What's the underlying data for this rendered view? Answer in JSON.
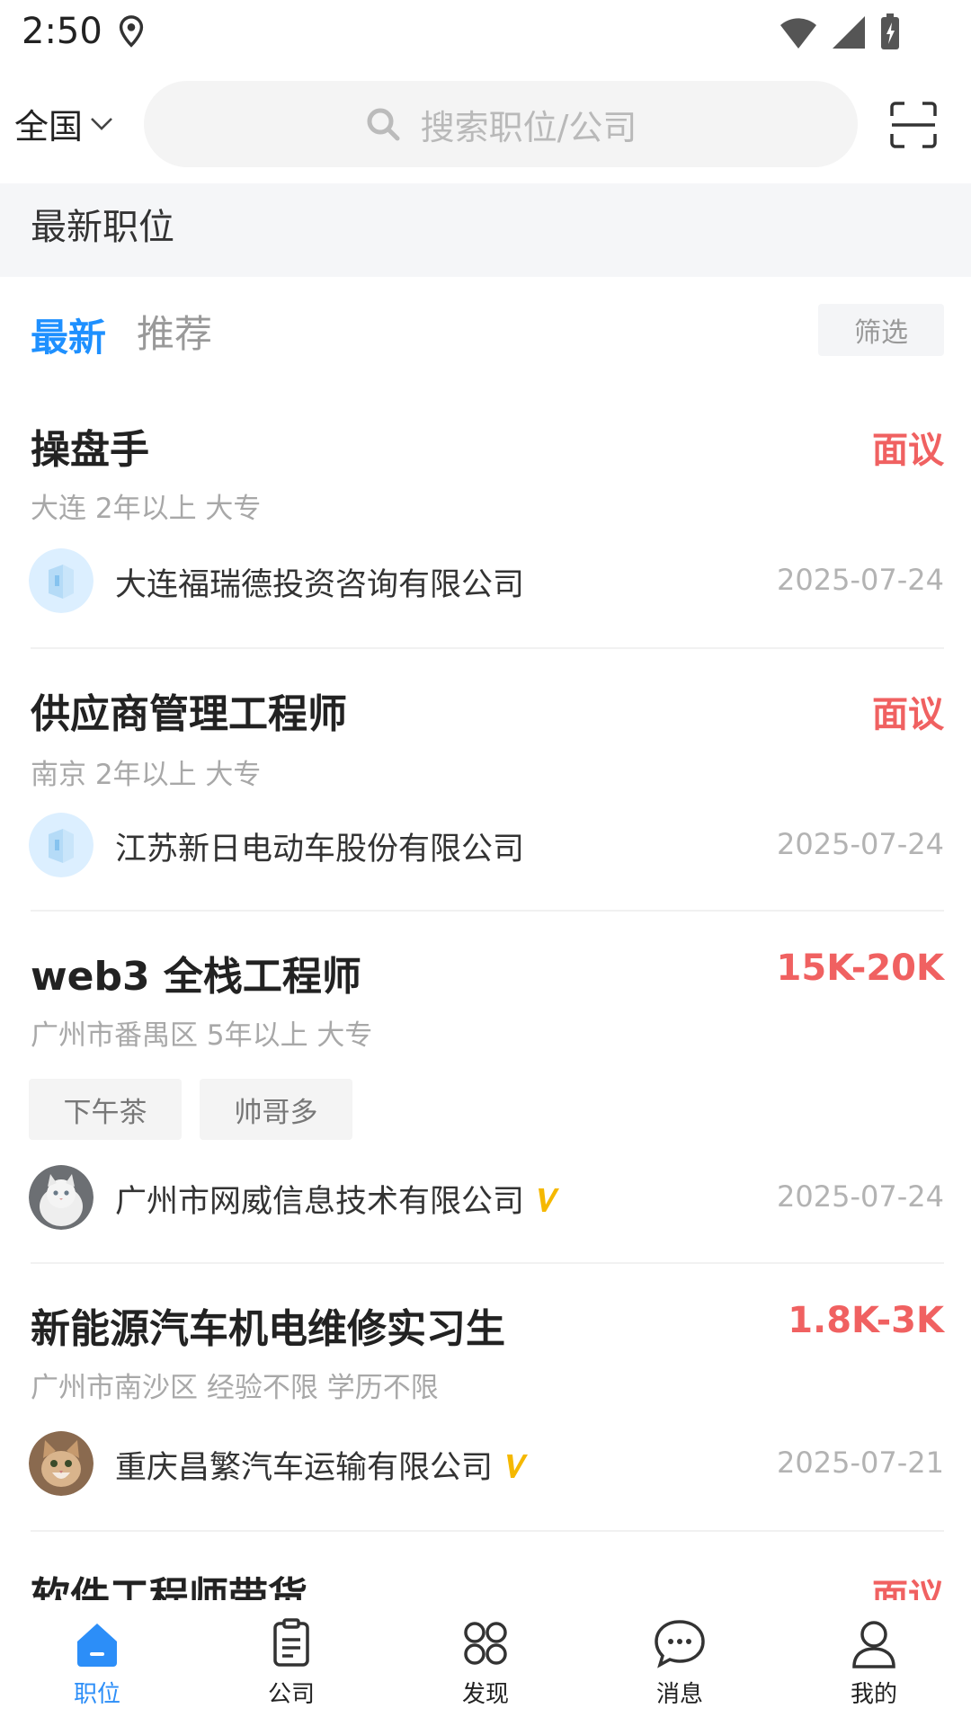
{
  "status_bar": {
    "time": "2:50"
  },
  "header": {
    "region": "全国",
    "search_placeholder": "搜索职位/公司"
  },
  "section": {
    "title": "最新职位"
  },
  "tabs": {
    "latest": "最新",
    "recommend": "推荐",
    "filter": "筛选"
  },
  "jobs": [
    {
      "title": "操盘手",
      "salary": "面议",
      "meta": "大连 2年以上 大专",
      "tags": [],
      "company": "大连福瑞德投资咨询有限公司",
      "verified": false,
      "date": "2025-07-24",
      "logo": "default-building-logo"
    },
    {
      "title": "供应商管理工程师",
      "salary": "面议",
      "meta": "南京 2年以上 大专",
      "tags": [],
      "company": "江苏新日电动车股份有限公司",
      "verified": false,
      "date": "2025-07-24",
      "logo": "default-building-logo"
    },
    {
      "title": "web3 全栈工程师",
      "salary": "15K-20K",
      "meta": "广州市番禺区 5年以上 大专",
      "tags": [
        "下午茶",
        "帅哥多"
      ],
      "company": "广州市网威信息技术有限公司",
      "verified": true,
      "date": "2025-07-24",
      "logo": "white-cat-photo"
    },
    {
      "title": "新能源汽车机电维修实习生",
      "salary": "1.8K-3K",
      "meta": "广州市南沙区 经验不限 学历不限",
      "tags": [],
      "company": "重庆昌繁汽车运输有限公司",
      "verified": true,
      "date": "2025-07-21",
      "logo": "kitten-photo"
    },
    {
      "title": "软件工程师带货",
      "salary": "面议",
      "meta": "",
      "tags": [],
      "company": "",
      "verified": false,
      "date": "",
      "logo": ""
    }
  ],
  "bottom_nav": [
    {
      "label": "职位",
      "icon": "home-icon",
      "active": true
    },
    {
      "label": "公司",
      "icon": "clipboard-icon",
      "active": false
    },
    {
      "label": "发现",
      "icon": "grid-icon",
      "active": false
    },
    {
      "label": "消息",
      "icon": "chat-icon",
      "active": false
    },
    {
      "label": "我的",
      "icon": "user-icon",
      "active": false
    }
  ],
  "colors": {
    "accent": "#1e90ff",
    "salary": "#f06161",
    "verified": "#f5b800",
    "nav_active": "#2c8ef8"
  }
}
